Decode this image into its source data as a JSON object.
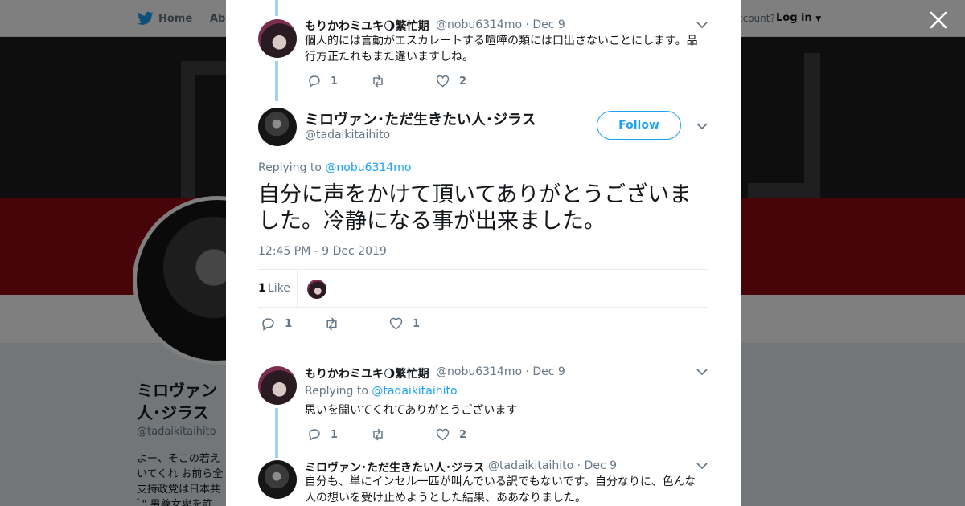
{
  "background": {
    "nav": {
      "home": "Home",
      "about": "Abo",
      "account": "ccount?",
      "login": "Log in"
    },
    "profile": {
      "name": "ミロヴァン\n人･ジラス",
      "handle": "@tadaikitaihito",
      "bio": "よー、そこの若え\nいてくれ お前ら全\n支持政党は日本共\nﾞ\" 男尊女卑を許"
    }
  },
  "modal": {
    "tweet1": {
      "name": "もりかわミユキ🌖繁忙期",
      "handle": "@nobu6314mo",
      "date": "· Dec 9",
      "text": "個人的には言動がエスカレートする喧嘩の類には口出さないことにします。品行方正たれもまた違いますしね。",
      "replies": "1",
      "retweets": "",
      "likes": "2"
    },
    "main": {
      "name": "ミロヴァン･ただ生きたい人･ジラス",
      "handle": "@tadaikitaihito",
      "follow_label": "Follow",
      "replying_prefix": "Replying to",
      "replying_to": "@nobu6314mo",
      "text": "自分に声をかけて頂いてありがとうございました。冷静になる事が出来ました。",
      "timestamp": "12:45 PM - 9 Dec 2019",
      "like_count": "1",
      "like_label": "Like",
      "replies": "1",
      "retweets": "",
      "likes": "1"
    },
    "tweet3": {
      "name": "もりかわミユキ🌖繁忙期",
      "handle": "@nobu6314mo",
      "date": "· Dec 9",
      "replying_prefix": "Replying to",
      "replying_to": "@tadaikitaihito",
      "text": "思いを聞いてくれてありがとうございます",
      "replies": "1",
      "retweets": "",
      "likes": "2"
    },
    "tweet4": {
      "name": "ミロヴァン･ただ生きたい人･ジラス",
      "handle": "@tadaikitaihito",
      "date": "· Dec 9",
      "text": "自分も、単にインセル一匹が叫んでいる訳でもないです。自分なりに、色んな人の想いを受け止めようとした結果、ああなりました。"
    }
  },
  "colors": {
    "accent": "#1da1f2",
    "thread": "#9dd4f5",
    "muted": "#657786"
  }
}
